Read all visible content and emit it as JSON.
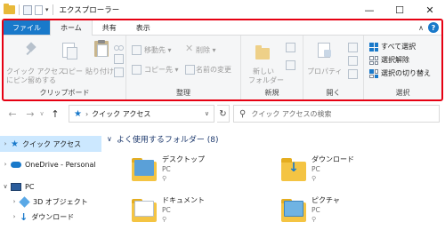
{
  "window": {
    "title": "エクスプローラー",
    "controls": {
      "minimize": "—",
      "maximize": "☐",
      "close": "✕"
    }
  },
  "ribbon": {
    "tabs": [
      {
        "label": "ファイル"
      },
      {
        "label": "ホーム"
      },
      {
        "label": "共有"
      },
      {
        "label": "表示"
      }
    ],
    "active_tab": "ホーム",
    "help": "?",
    "groups": {
      "clipboard": {
        "label": "クリップボード",
        "pin_label_line1": "クイック アクセス",
        "pin_label_line2": "にピン留めする",
        "copy": "コピー",
        "paste": "貼り付け"
      },
      "organize": {
        "label": "整理",
        "move_to": "移動先 ▾",
        "copy_to": "コピー先 ▾",
        "delete": "削除 ▾",
        "rename": "名前の変更"
      },
      "new": {
        "label": "新規",
        "new_folder_line1": "新しい",
        "new_folder_line2": "フォルダー"
      },
      "open": {
        "label": "開く",
        "properties": "プロパティ"
      },
      "select": {
        "label": "選択",
        "select_all": "すべて選択",
        "select_none": "選択解除",
        "invert": "選択の切り替え"
      }
    }
  },
  "address": {
    "path": "クイック アクセス",
    "search_placeholder": "クイック アクセスの検索"
  },
  "nav_pane": {
    "items": [
      {
        "label": "クイック アクセス",
        "selected": true
      },
      {
        "label": "OneDrive - Personal"
      },
      {
        "label": "PC"
      },
      {
        "label": "3D オブジェクト"
      },
      {
        "label": "ダウンロード"
      }
    ]
  },
  "content": {
    "section_title": "よく使用するフォルダー (8)",
    "folders": [
      {
        "name": "デスクトップ",
        "location": "PC"
      },
      {
        "name": "ダウンロード",
        "location": "PC"
      },
      {
        "name": "ドキュメント",
        "location": "PC"
      },
      {
        "name": "ピクチャ",
        "location": "PC"
      }
    ]
  },
  "colors": {
    "accent": "#1979ca",
    "highlight_frame": "#e60012",
    "folder": "#f4c443",
    "selected_bg": "#cce8ff"
  }
}
